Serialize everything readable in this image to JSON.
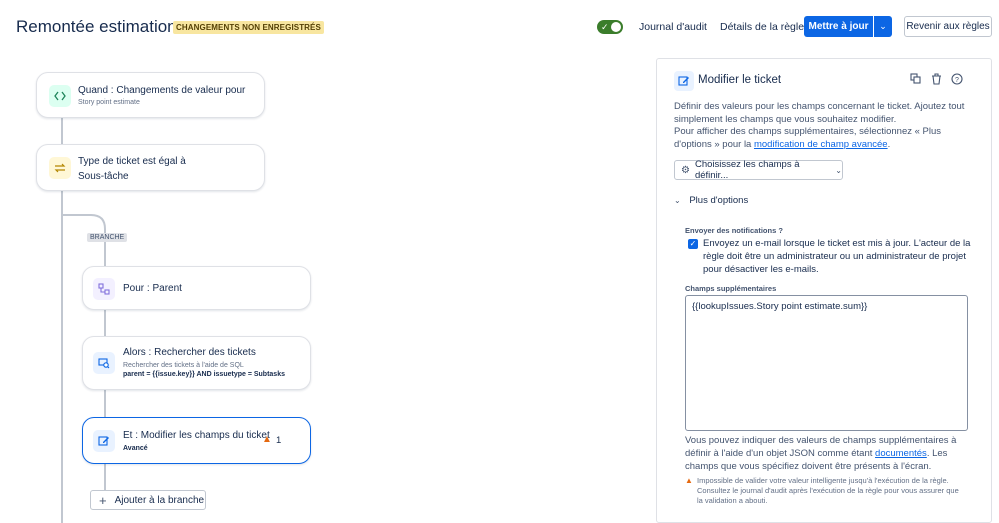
{
  "header": {
    "title": "Remontée estimation",
    "unsaved_badge": "CHANGEMENTS NON ENREGISTRÉS",
    "toggle_on": true,
    "audit_link": "Journal d'audit",
    "details_link": "Détails de la règle",
    "update_button": "Mettre à jour",
    "revert_button": "Revenir aux règles"
  },
  "flow": {
    "trigger": {
      "title": "Quand : Changements de valeur pour",
      "subtitle": "Story point estimate",
      "icon": "trigger-icon"
    },
    "condition": {
      "title": "Type de ticket est égal à",
      "subtitle": "Sous-tâche",
      "icon": "condition-icon"
    },
    "branch_tag": "BRANCHE",
    "branch_for": {
      "title": "Pour : Parent",
      "icon": "branch-icon"
    },
    "search": {
      "title": "Alors : Rechercher des tickets",
      "subtitle": "Rechercher des tickets à l'aide de SQL",
      "query": "parent = {{issue.key}} AND issuetype = Subtasks",
      "icon": "search-tickets-icon"
    },
    "edit": {
      "title": "Et : Modifier les champs du ticket",
      "subtitle": "Avancé",
      "warning_count": "1",
      "icon": "edit-icon"
    },
    "add_branch": "Ajouter à la branche"
  },
  "panel": {
    "title": "Modifier le ticket",
    "description_1": "Définir des valeurs pour les champs concernant le ticket. Ajoutez tout simplement les champs que vous souhaitez modifier.",
    "description_2_pre": "Pour afficher des champs supplémentaires, sélectionnez « Plus d'options » pour la ",
    "description_2_link": "modification de champ avancée",
    "description_2_post": ".",
    "choose_fields": "Choisissez les champs à définir...",
    "more_options": "Plus d'options",
    "notify_label": "Envoyer des notifications ?",
    "notify_checked": true,
    "notify_text": "Envoyez un e-mail lorsque le ticket est mis à jour. L'acteur de la règle doit être un administrateur ou un administrateur de projet pour désactiver les e-mails.",
    "extra_fields_label": "Champs supplémentaires",
    "extra_fields_value": "{{lookupIssues.Story point estimate.sum}}",
    "help_pre": "Vous pouvez indiquer des valeurs de champs supplémentaires à définir à l'aide d'un objet JSON comme étant ",
    "help_link": "documentés",
    "help_post": ". Les champs que vous spécifiez doivent être présents à l'écran.",
    "warning": "Impossible de valider votre valeur intelligente jusqu'à l'exécution de la règle. Consultez le journal d'audit après l'exécution de la règle pour vous assurer que la validation a abouti."
  }
}
